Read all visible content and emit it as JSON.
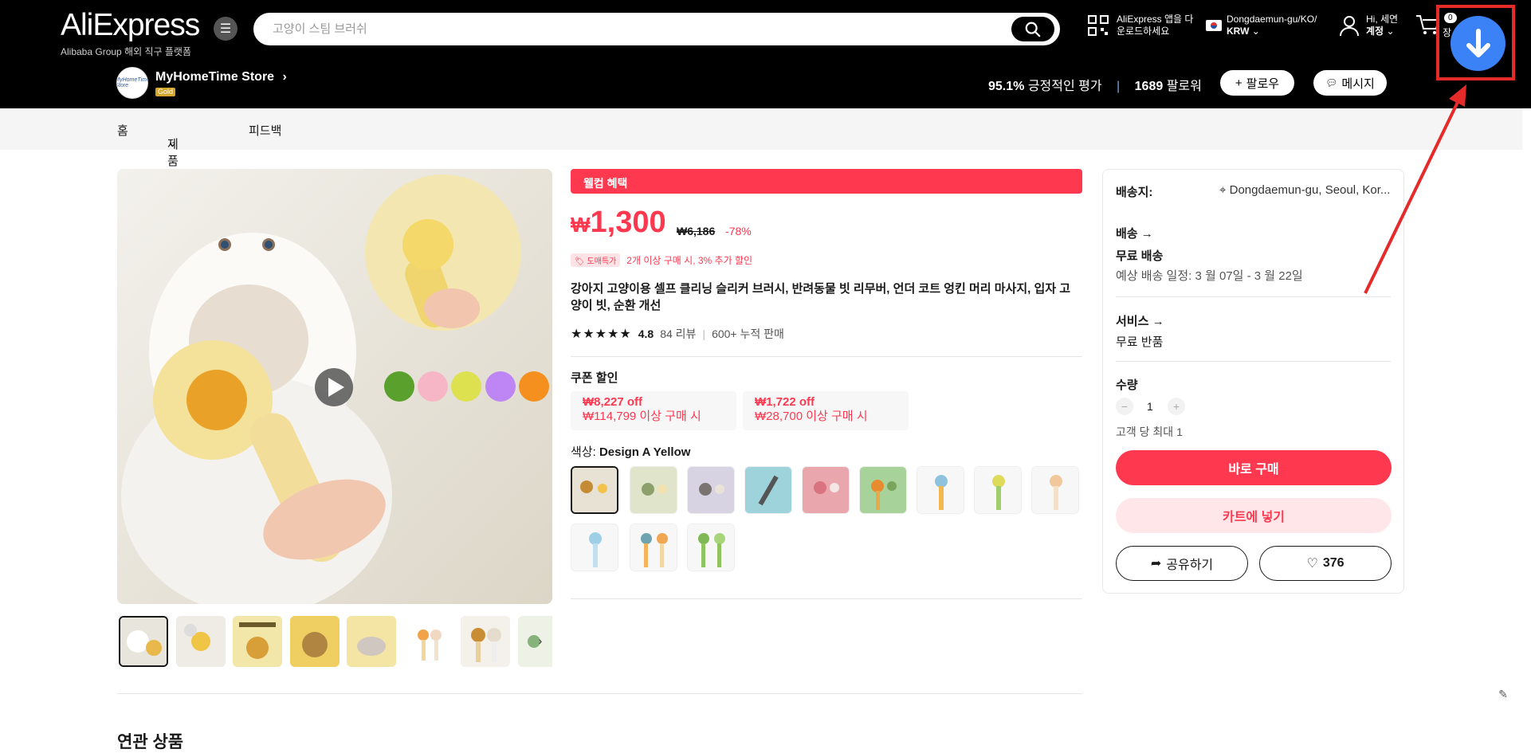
{
  "header": {
    "logo": "AliExpress",
    "logo_sub": "Alibaba Group 해외 직구 플랫폼",
    "search_placeholder": "고양이 스팀 브러쉬",
    "app_line1": "AliExpress 앱을 다",
    "app_line2": "운로드하세요",
    "region_line1": "Dongdaemun-gu/KO/",
    "region_line2": "KRW",
    "account_line1": "Hi, 세연",
    "account_line2": "계정",
    "cart_count": "0",
    "cart_partial": "장"
  },
  "store": {
    "logo_text": "MyHomeTime Store",
    "name": "MyHomeTime Store",
    "badge": "Gold",
    "positive_pct": "95.1%",
    "positive_label": "긍정적인 평가",
    "followers": "1689",
    "followers_label": "팔로워",
    "follow_btn": "팔로우",
    "message_btn": "메시지"
  },
  "subnav": {
    "home": "홈",
    "products": "제품",
    "feedback": "피드백"
  },
  "product": {
    "welcome": "웰컴 혜택",
    "currency": "₩",
    "price": "1,300",
    "original_price": "₩6,186",
    "discount": "-78%",
    "promo_tag": "도매특가",
    "promo_text": "2개 이상 구매 시, 3% 추가 할인",
    "title": "강아지 고양이용 셀프 클리닝 슬리커 브러시, 반려동물 빗 리무버, 언더 코트 엉킨 머리 마사지, 입자 고양이 빗, 순환 개선",
    "rating": "4.8",
    "reviews": "84 리뷰",
    "sold": "600+ 누적 판매",
    "coupon_heading": "쿠폰 할인",
    "coupons": [
      {
        "off": "₩8,227 off",
        "cond": "₩114,799 이상 구매 시"
      },
      {
        "off": "₩1,722 off",
        "cond": "₩28,700 이상 구매 시"
      }
    ],
    "color_label": "색상:",
    "color_value": "Design A Yellow"
  },
  "panel": {
    "ship_to_label": "배송지:",
    "ship_to_value": "Dongdaemun-gu, Seoul, Kor...",
    "shipping_label": "배송",
    "free_shipping": "무료 배송",
    "delivery_est": "예상 배송 일정: 3 월 07일 - 3 월 22일",
    "service_label": "서비스",
    "free_return": "무료 반품",
    "qty_label": "수량",
    "qty_value": "1",
    "max_per": "고객 당 최대 1",
    "buy_now": "바로 구매",
    "add_cart": "카트에 넣기",
    "share": "공유하기",
    "likes": "376"
  },
  "related_title": "연관 상품",
  "colors": {
    "accent": "#fd384f",
    "header_bg": "#000000",
    "annotation_red": "#e52a2a",
    "download_blue": "#3b82f6"
  }
}
